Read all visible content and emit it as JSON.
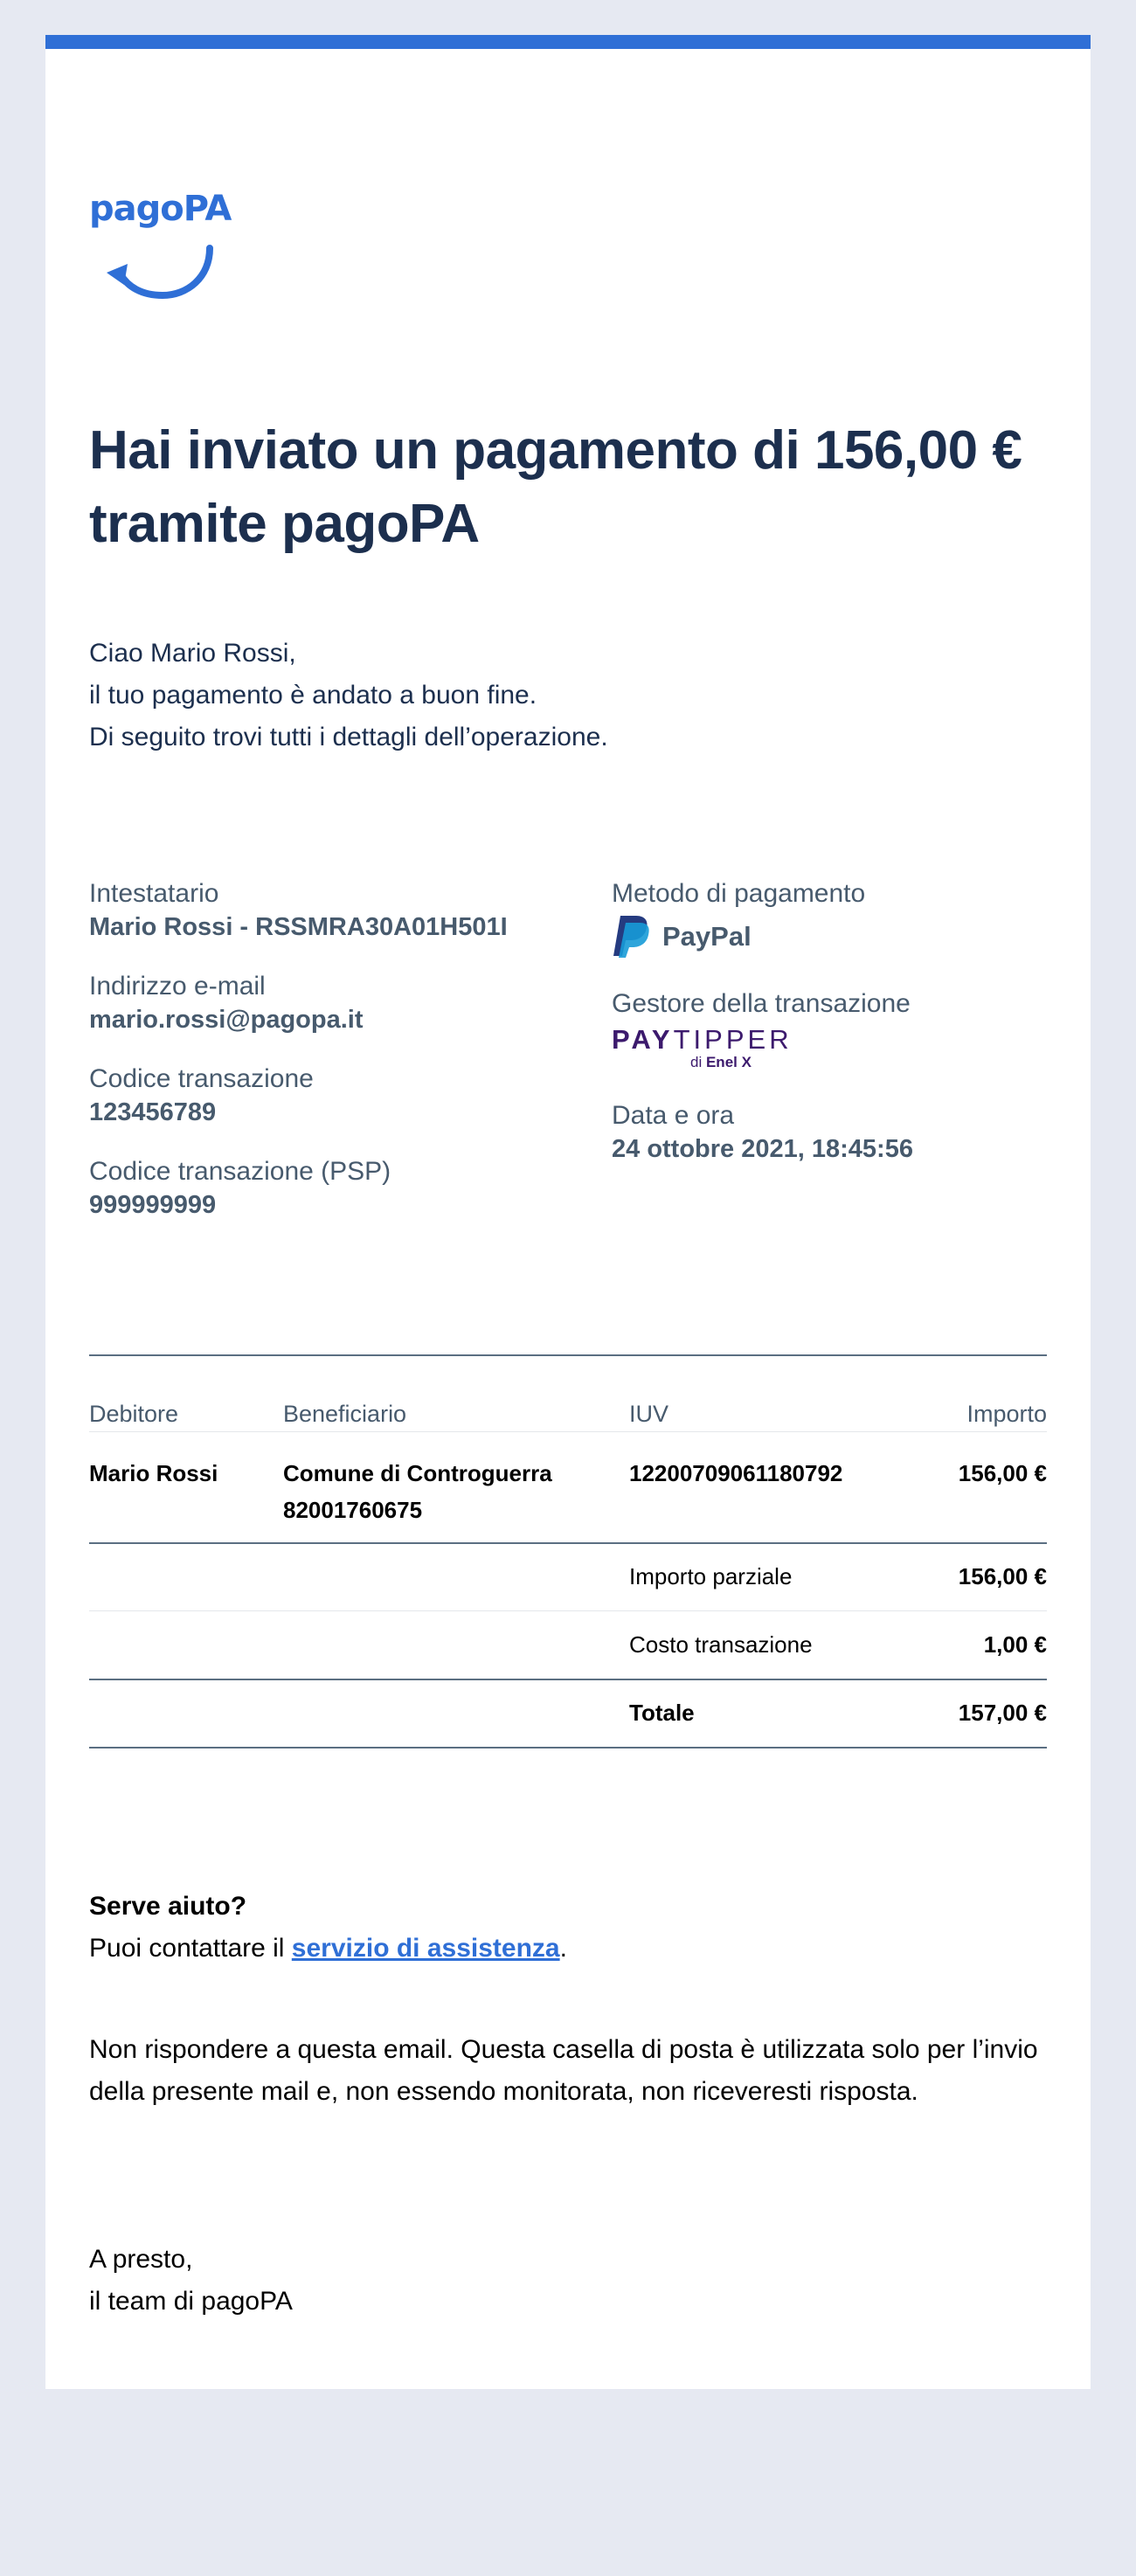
{
  "brand": {
    "logo_text": "pagoPA",
    "accent_color": "#2f6fd6",
    "heading_color": "#1c2f4e"
  },
  "headline": {
    "line1": "Hai inviato un pagamento di 156,00 €",
    "line2": "tramite pagoPA"
  },
  "greeting": {
    "line1": "Ciao Mario Rossi,",
    "line2": "il tuo pagamento è andato a buon fine.",
    "line3": "Di seguito trovi tutti i dettagli dell’operazione."
  },
  "details": {
    "holder_label": "Intestatario",
    "holder_value": "Mario Rossi - RSSMRA30A01H501I",
    "email_label": "Indirizzo e-mail",
    "email_value": "mario.rossi@pagopa.it",
    "tx_code_label": "Codice transazione",
    "tx_code_value": "123456789",
    "psp_code_label": "Codice transazione (PSP)",
    "psp_code_value": "999999999",
    "method_label": "Metodo di pagamento",
    "method_value": "PayPal",
    "method_icon": "paypal-icon",
    "manager_label": "Gestore della transazione",
    "manager_logo_pay": "PAY",
    "manager_logo_tipper": "TIPPER",
    "manager_logo_sub": "di",
    "manager_logo_sub_brand": "Enel X",
    "datetime_label": "Data e ora",
    "datetime_value": "24 ottobre 2021, 18:45:56"
  },
  "table": {
    "headers": {
      "debtor": "Debitore",
      "beneficiary": "Beneficiario",
      "iuv": "IUV",
      "amount": "Importo"
    },
    "row": {
      "debtor": "Mario Rossi",
      "beneficiary_name": "Comune di Controguerra",
      "beneficiary_code": "82001760675",
      "iuv": "12200709061180792",
      "amount": "156,00 €"
    },
    "partial_label": "Importo parziale",
    "partial_value": "156,00 €",
    "fee_label": "Costo transazione",
    "fee_value": "1,00 €",
    "total_label": "Totale",
    "total_value": "157,00 €"
  },
  "help": {
    "title": "Serve aiuto?",
    "text_before": "Puoi contattare il ",
    "link_text": "servizio di assistenza",
    "text_after": "."
  },
  "noreply": {
    "line1": "Non rispondere a questa email. Questa casella di posta è utilizzata solo per l’invio",
    "line2": "della presente mail e, non essendo monitorata, non riceveresti risposta."
  },
  "signoff": {
    "line1": "A presto,",
    "line2": "il team di pagoPA"
  }
}
